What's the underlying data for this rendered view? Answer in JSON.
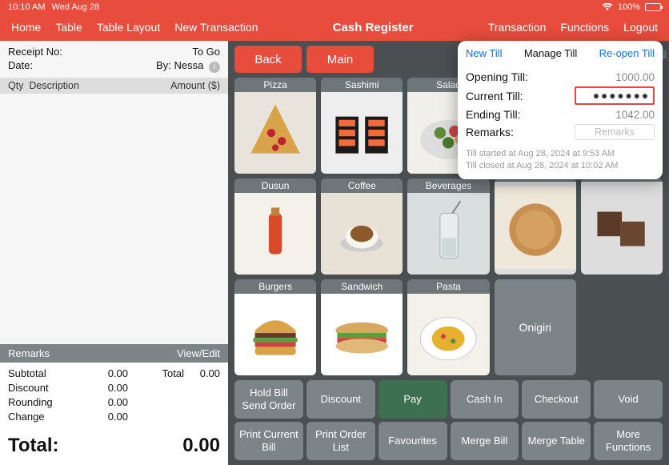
{
  "status": {
    "time": "10:10 AM",
    "date": "Wed Aug 28",
    "battery": "100%"
  },
  "nav": {
    "left": [
      "Home",
      "Table",
      "Table Layout",
      "New Transaction"
    ],
    "title": "Cash Register",
    "right": [
      "Transaction",
      "Functions",
      "Logout"
    ]
  },
  "receipt": {
    "receipt_no_label": "Receipt No:",
    "order_type": "To Go",
    "date_label": "Date:",
    "by_label": "By:",
    "by_value": "Nessa",
    "headers": {
      "qty": "Qty",
      "desc": "Description",
      "amount": "Amount ($)"
    },
    "remarks_label": "Remarks",
    "view_edit": "View/Edit",
    "rows": [
      {
        "label": "Subtotal",
        "value": "0.00",
        "label2": "Total",
        "value2": "0.00"
      },
      {
        "label": "Discount",
        "value": "0.00",
        "label2": "",
        "value2": ""
      },
      {
        "label": "Rounding",
        "value": "0.00",
        "label2": "",
        "value2": ""
      },
      {
        "label": "Change",
        "value": "0.00",
        "label2": "",
        "value2": ""
      }
    ],
    "total_label": "Total:",
    "total_value": "0.00"
  },
  "top_buttons": {
    "back": "Back",
    "main": "Main"
  },
  "products": [
    "Pizza",
    "Sashimi",
    "Salad",
    "",
    "",
    "Dusun",
    "Coffee",
    "Beverages",
    "",
    "",
    "Burgers",
    "Sandwich",
    "Pasta",
    "Onigiri",
    ""
  ],
  "actions_row1": [
    "Hold Bill Send Order",
    "Discount",
    "Pay",
    "Cash In",
    "Checkout",
    "Void"
  ],
  "actions_row2": [
    "Print Current Bill",
    "Print Order List",
    "Favourites",
    "Merge Bill",
    "Merge Table",
    "More Functions"
  ],
  "popover": {
    "tabs": [
      "New Till",
      "Manage Till",
      "Re-open Till"
    ],
    "rows": [
      {
        "label": "Opening Till:",
        "value": "1000.00",
        "style": "plain"
      },
      {
        "label": "Current Till:",
        "value": "●●●●●●●",
        "style": "boxed"
      },
      {
        "label": "Ending Till:",
        "value": "1042.00",
        "style": "plain"
      },
      {
        "label": "Remarks:",
        "value": "Remarks",
        "style": "input"
      }
    ],
    "foot1": "Till started at Aug 28, 2024 at 9:53 AM",
    "foot2": "Till closed at Aug 28, 2024 at 10:02 AM"
  }
}
